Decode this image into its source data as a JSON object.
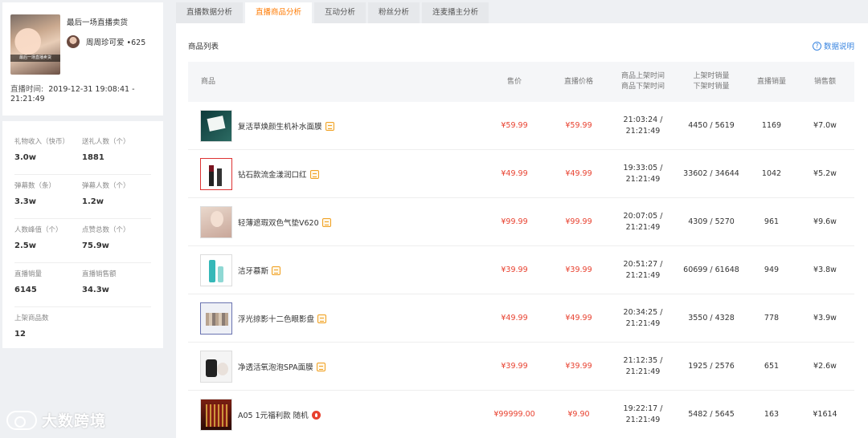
{
  "live": {
    "title": "最后一场直播卖货",
    "cover_caption": "最后一场直播卖货",
    "anchor_name": "周周珍可爱 •625",
    "time_label": "直播时间:",
    "time_start": "2019-12-31 19:08:41 -",
    "time_end": "21:21:49"
  },
  "stats": [
    {
      "label": "礼物收入（快币）",
      "value": "3.0w"
    },
    {
      "label": "送礼人数（个）",
      "value": "1881"
    },
    {
      "label": "弹幕数（条）",
      "value": "3.3w"
    },
    {
      "label": "弹幕人数（个）",
      "value": "1.2w"
    },
    {
      "label": "人数峰值（个）",
      "value": "2.5w"
    },
    {
      "label": "点赞总数（个）",
      "value": "75.9w"
    },
    {
      "label": "直播销量",
      "value": "6145"
    },
    {
      "label": "直播销售额",
      "value": "34.3w"
    },
    {
      "label": "上架商品数",
      "value": "12"
    }
  ],
  "watermark": "大数跨境",
  "tabs": [
    "直播数据分析",
    "直播商品分析",
    "互动分析",
    "粉丝分析",
    "连麦播主分析"
  ],
  "active_tab": 1,
  "section_title": "商品列表",
  "help_label": "数据说明",
  "table": {
    "headers": {
      "product": "商品",
      "price": "售价",
      "live_price": "直播价格",
      "time_line1": "商品上架时间",
      "time_line2": "商品下架时间",
      "sales_line1": "上架时销量",
      "sales_line2": "下架时销量",
      "live_sales": "直播销量",
      "revenue": "销售额"
    },
    "rows": [
      {
        "name": "复活草焕颜生机补水面膜",
        "tag": "shop-tag-icon",
        "price": "¥59.99",
        "live_price": "¥59.99",
        "on_time": "21:03:24 /",
        "off_time": "21:21:49",
        "sales": "4450 / 5619",
        "live_sales": "1169",
        "revenue": "¥7.0w"
      },
      {
        "name": "钻石款流金漾润口红",
        "tag": "shop-tag-icon",
        "price": "¥49.99",
        "live_price": "¥49.99",
        "on_time": "19:33:05 /",
        "off_time": "21:21:49",
        "sales": "33602 / 34644",
        "live_sales": "1042",
        "revenue": "¥5.2w"
      },
      {
        "name": "轻薄遮瑕双色气垫V620",
        "tag": "shop-tag-icon",
        "price": "¥99.99",
        "live_price": "¥99.99",
        "on_time": "20:07:05 /",
        "off_time": "21:21:49",
        "sales": "4309 / 5270",
        "live_sales": "961",
        "revenue": "¥9.6w"
      },
      {
        "name": "洁牙慕斯",
        "tag": "shop-tag-icon",
        "price": "¥39.99",
        "live_price": "¥39.99",
        "on_time": "20:51:27 /",
        "off_time": "21:21:49",
        "sales": "60699 / 61648",
        "live_sales": "949",
        "revenue": "¥3.8w"
      },
      {
        "name": "浮光掠影十二色眼影盘",
        "tag": "shop-tag-icon",
        "price": "¥49.99",
        "live_price": "¥49.99",
        "on_time": "20:34:25 /",
        "off_time": "21:21:49",
        "sales": "3550 / 4328",
        "live_sales": "778",
        "revenue": "¥3.9w"
      },
      {
        "name": "净透活氧泡泡SPA面膜",
        "tag": "shop-tag-icon",
        "price": "¥39.99",
        "live_price": "¥39.99",
        "on_time": "21:12:35 /",
        "off_time": "21:21:49",
        "sales": "1925 / 2576",
        "live_sales": "651",
        "revenue": "¥2.6w"
      },
      {
        "name": "A05 1元福利款 随机",
        "tag": "hot-tag-icon",
        "price": "¥99999.00",
        "live_price": "¥9.90",
        "on_time": "19:22:17 /",
        "off_time": "21:21:49",
        "sales": "5482 / 5645",
        "live_sales": "163",
        "revenue": "¥1614"
      }
    ]
  }
}
